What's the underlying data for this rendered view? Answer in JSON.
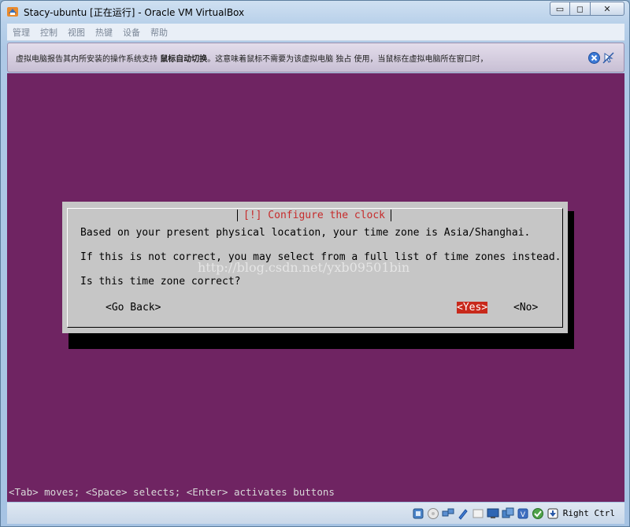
{
  "window": {
    "title": "Stacy-ubuntu [正在运行] - Oracle VM VirtualBox",
    "minimize_glyph": "▭",
    "maximize_glyph": "◻",
    "close_glyph": "✕"
  },
  "menubar": {
    "items": [
      "管理",
      "控制",
      "视图",
      "热键",
      "设备",
      "帮助"
    ]
  },
  "notice": {
    "text_before": "虚拟电脑报告其内所安装的操作系统支持 ",
    "text_bold": "鼠标自动切换",
    "text_after": "。这意味着鼠标不需要为该虚拟电脑 独占 使用，当鼠标在虚拟电脑所在窗口时，"
  },
  "guest": {
    "background": "#6f2462",
    "dialog": {
      "title": "[!] Configure the clock",
      "lines": [
        "Based on your present physical location, your time zone is Asia/Shanghai.",
        "If this is not correct, you may select from a full list of time zones instead.",
        "Is this time zone correct?"
      ],
      "buttons": {
        "back": "<Go Back>",
        "yes": "<Yes>",
        "no": "<No>"
      }
    },
    "watermark": "http://blog.csdn.net/yxb09501bin",
    "hint": "<Tab> moves; <Space> selects; <Enter> activates buttons"
  },
  "statusbar": {
    "host_key": "Right Ctrl"
  },
  "colors": {
    "guest_bg": "#6f2462",
    "dialog_bg": "#c6c6c6",
    "dialog_title": "#c62b2b",
    "selected_button": "#c8291b"
  }
}
